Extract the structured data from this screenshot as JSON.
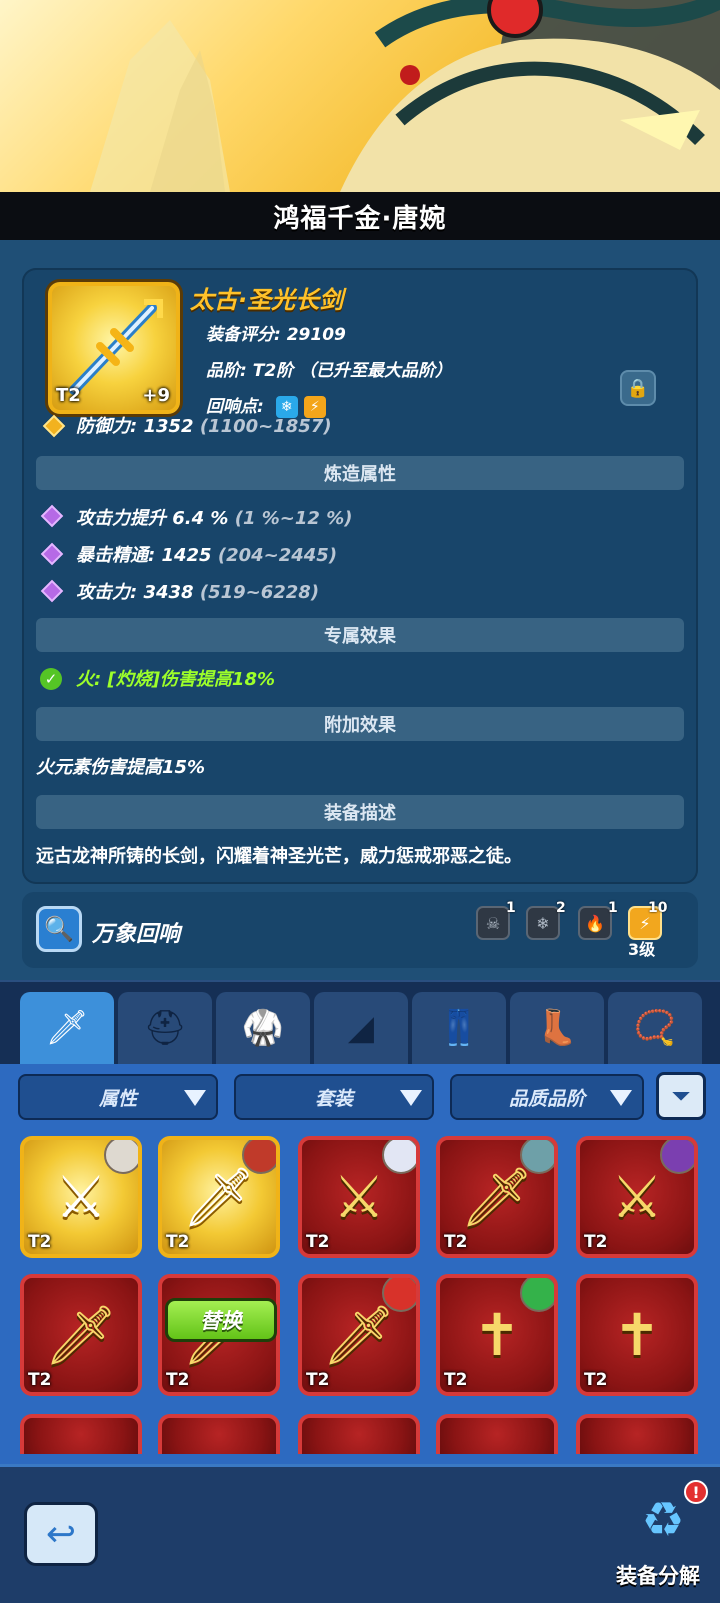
{
  "hero": {
    "name": "鸿福千金·唐婉"
  },
  "item": {
    "title": "太古·圣光长剑",
    "tier_badge": "T2",
    "plus_level": "+9",
    "score_line": "装备评分: 29109",
    "grade_line": "品阶: T2阶 （已升至最大品阶）",
    "echo_points_label": "回响点:",
    "echo_badges": [
      "snowflake-icon",
      "lightning-icon"
    ],
    "base_stat": {
      "label": "防御力: 1352",
      "range": "(1100~1857)"
    }
  },
  "sections": {
    "forge": "炼造属性",
    "exclusive": "专属效果",
    "bonus": "附加效果",
    "description": "装备描述"
  },
  "forge_stats": [
    {
      "label": "攻击力提升 6.4 %",
      "range": "(1 %~12 %)"
    },
    {
      "label": "暴击精通: 1425",
      "range": "(204~2445)"
    },
    {
      "label": "攻击力: 3438",
      "range": "(519~6228)"
    }
  ],
  "exclusive_effect": "火: [灼烧]伤害提高18%",
  "bonus_effect": "火元素伤害提高15%",
  "description_text": "远古龙神所铸的长剑，闪耀着神圣光芒，威力惩戒邪恶之徒。",
  "echo": {
    "label": "万象回响",
    "elements": [
      {
        "icon": "skull-icon",
        "count": "1"
      },
      {
        "icon": "snowflake-icon",
        "count": "2"
      },
      {
        "icon": "fire-icon",
        "count": "1"
      },
      {
        "icon": "lightning-icon",
        "count": "10"
      }
    ],
    "level": "3级"
  },
  "tabs": [
    "weapon",
    "helmet",
    "armor",
    "bracer",
    "pants",
    "boots",
    "necklace"
  ],
  "filters": {
    "attribute": "属性",
    "set": "套装",
    "quality": "品质品阶"
  },
  "grid": {
    "tier_label": "T2",
    "replace_label": "替换"
  },
  "bottom": {
    "dismantle_label": "装备分解",
    "alert": "!"
  },
  "colors": {
    "accent_gold": "#ffc22a",
    "effect_green": "#9dff2a",
    "rarity_red": "#d63a3a",
    "rarity_gold": "#f0b318"
  }
}
